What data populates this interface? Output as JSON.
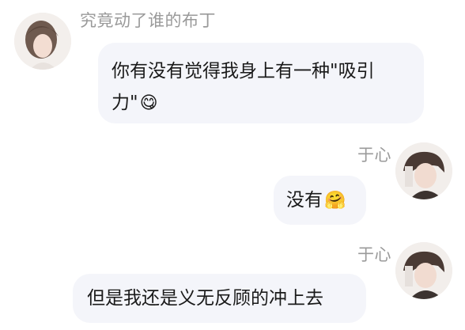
{
  "messages": [
    {
      "sender": "究竟动了谁的布丁",
      "text": "你有没有觉得我身上有一种\"吸引力\"",
      "emoji": "😋",
      "side": "left",
      "avatar_icon": "user-avatar-icon"
    },
    {
      "sender": "于心",
      "text": "没有",
      "emoji": "🤗",
      "side": "right",
      "avatar_icon": "user-avatar-icon"
    },
    {
      "sender": "于心",
      "text": "但是我还是义无反顾的冲上去",
      "emoji": "",
      "side": "right",
      "avatar_icon": "user-avatar-icon"
    }
  ],
  "colors": {
    "bubble": "#f4f5fa",
    "name": "#9a9a9a",
    "text": "#1a1a1a"
  }
}
